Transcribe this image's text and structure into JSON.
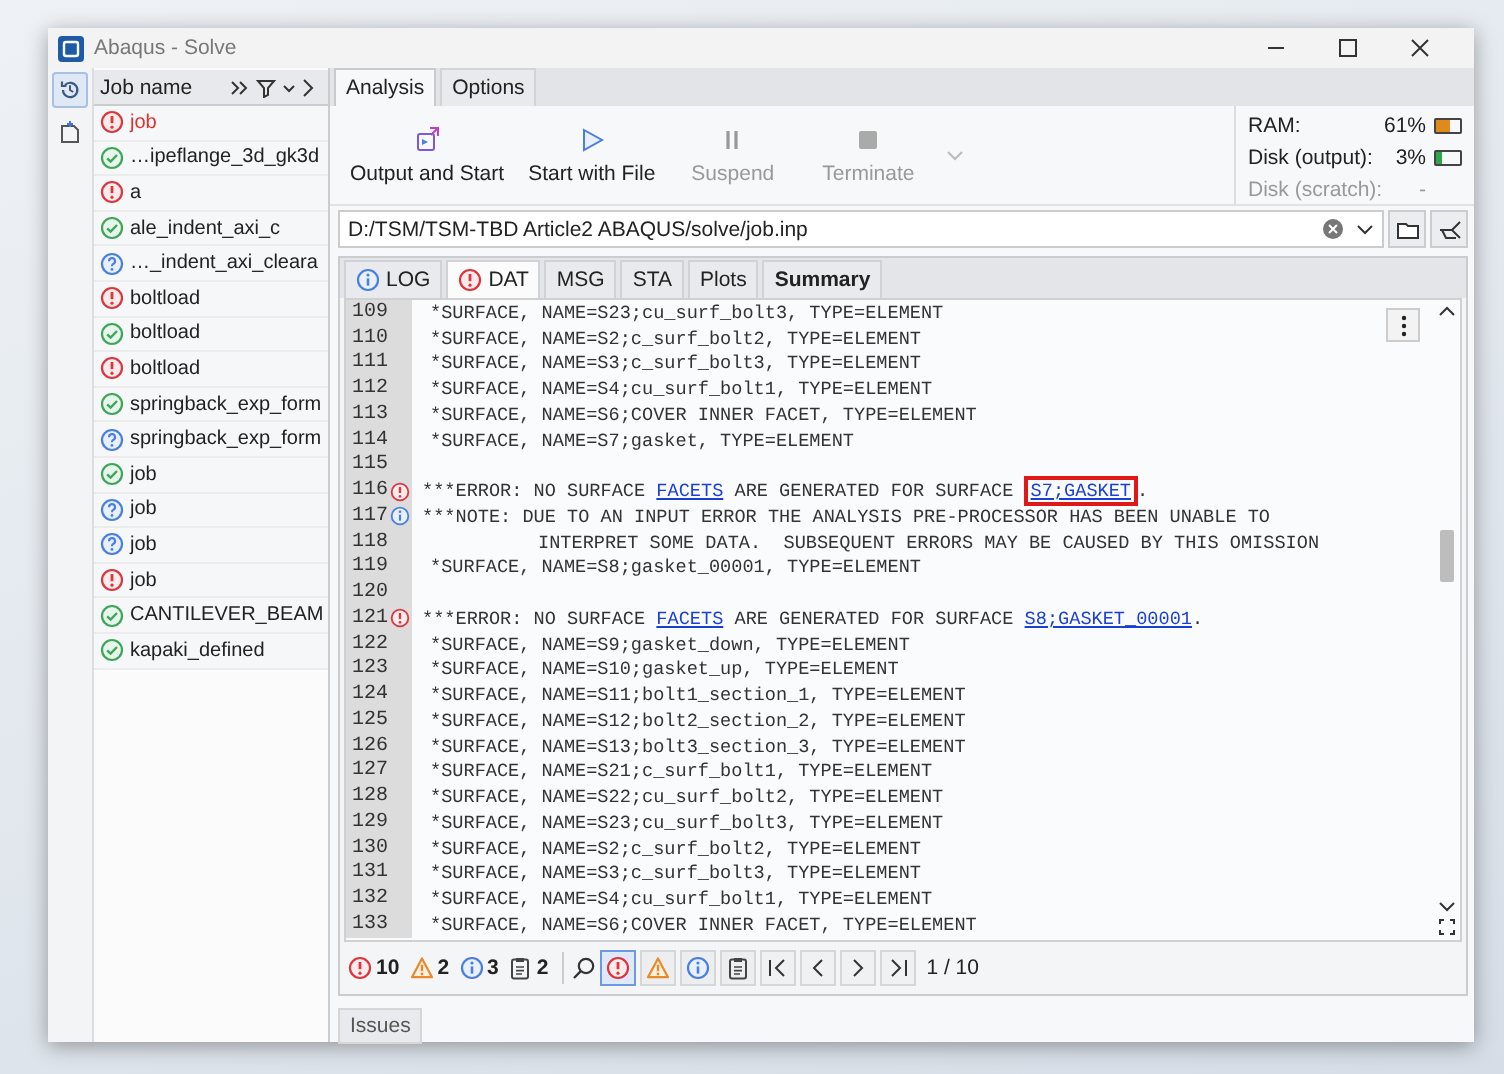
{
  "window": {
    "title": "Abaqus - Solve"
  },
  "jobs": {
    "header": "Job name",
    "items": [
      {
        "name": "job",
        "kind": "error",
        "active": true
      },
      {
        "name": "…ipeflange_3d_gk3d",
        "kind": "ok",
        "active": false
      },
      {
        "name": "a",
        "kind": "error",
        "active": false
      },
      {
        "name": "ale_indent_axi_c",
        "kind": "ok",
        "active": false
      },
      {
        "name": "…_indent_axi_cleara",
        "kind": "unknown",
        "active": false
      },
      {
        "name": "boltload",
        "kind": "error",
        "active": false
      },
      {
        "name": "boltload",
        "kind": "ok",
        "active": false
      },
      {
        "name": "boltload",
        "kind": "error",
        "active": false
      },
      {
        "name": "springback_exp_form",
        "kind": "ok",
        "active": false
      },
      {
        "name": "springback_exp_form",
        "kind": "unknown",
        "active": false
      },
      {
        "name": "job",
        "kind": "ok",
        "active": false
      },
      {
        "name": "job",
        "kind": "unknown",
        "active": false
      },
      {
        "name": "job",
        "kind": "unknown",
        "active": false
      },
      {
        "name": "job",
        "kind": "error",
        "active": false
      },
      {
        "name": "CANTILEVER_BEAM",
        "kind": "ok",
        "active": false
      },
      {
        "name": "kapaki_defined",
        "kind": "ok",
        "active": false
      }
    ]
  },
  "tabs": [
    {
      "label": "Analysis",
      "selected": true
    },
    {
      "label": "Options",
      "selected": false
    }
  ],
  "toolbar": [
    {
      "label": "Output and Start",
      "kind": "output",
      "disabled": false
    },
    {
      "label": "Start with File",
      "kind": "play",
      "disabled": false
    },
    {
      "label": "Suspend",
      "kind": "pause",
      "disabled": true
    },
    {
      "label": "Terminate",
      "kind": "stop",
      "disabled": true
    }
  ],
  "resources": [
    {
      "label": "RAM:",
      "reading": "61%",
      "level": 0.61,
      "disabled": false
    },
    {
      "label": "Disk (output):",
      "reading": "3%",
      "level": 0.03,
      "disabled": false
    },
    {
      "label": "Disk (scratch):",
      "reading": "-",
      "disabled": true
    }
  ],
  "path": {
    "value": "D:/TSM/TSM-TBD Article2 ABAQUS/solve/job.inp"
  },
  "file_tabs": [
    {
      "label": "LOG",
      "kind": "info",
      "selected": false,
      "bold": false
    },
    {
      "label": "DAT",
      "kind": "error",
      "selected": true,
      "bold": false
    },
    {
      "label": "MSG",
      "kind": "plain",
      "selected": false,
      "bold": false
    },
    {
      "label": "STA",
      "kind": "plain",
      "selected": false,
      "bold": false
    },
    {
      "label": "Plots",
      "kind": "plain",
      "selected": false,
      "bold": false
    },
    {
      "label": "Summary",
      "kind": "plain",
      "selected": false,
      "bold": true
    }
  ],
  "lines": [
    {
      "number": "109",
      "kind": "plain",
      "parts": [
        {
          "text": "*SURFACE, NAME=S23;cu_surf_bolt3, TYPE=ELEMENT"
        }
      ]
    },
    {
      "number": "110",
      "kind": "plain",
      "parts": [
        {
          "text": "*SURFACE, NAME=S2;c_surf_bolt2, TYPE=ELEMENT"
        }
      ]
    },
    {
      "number": "111",
      "kind": "plain",
      "parts": [
        {
          "text": "*SURFACE, NAME=S3;c_surf_bolt3, TYPE=ELEMENT"
        }
      ]
    },
    {
      "number": "112",
      "kind": "plain",
      "parts": [
        {
          "text": "*SURFACE, NAME=S4;cu_surf_bolt1, TYPE=ELEMENT"
        }
      ]
    },
    {
      "number": "113",
      "kind": "plain",
      "parts": [
        {
          "text": "*SURFACE, NAME=S6;COVER INNER FACET, TYPE=ELEMENT"
        }
      ]
    },
    {
      "number": "114",
      "kind": "plain",
      "parts": [
        {
          "text": "*SURFACE, NAME=S7;gasket, TYPE=ELEMENT"
        }
      ]
    },
    {
      "number": "115",
      "kind": "plain"
    },
    {
      "number": "116",
      "kind": "error",
      "parts": [
        {
          "text": "***ERROR: NO SURFACE "
        },
        {
          "text": "FACETS",
          "link": true,
          "highlighted": false
        },
        {
          "text": " ARE GENERATED FOR SURFACE "
        },
        {
          "text": "S7;GASKET",
          "link": true,
          "highlighted": true
        },
        {
          "text": "."
        }
      ]
    },
    {
      "number": "117",
      "kind": "note",
      "parts": [
        {
          "text": "***NOTE: DUE TO AN INPUT ERROR THE ANALYSIS PRE-PROCESSOR HAS BEEN UNABLE TO"
        }
      ]
    },
    {
      "number": "118",
      "kind": "continuation",
      "parts": [
        {
          "text": "INTERPRET SOME DATA.  SUBSEQUENT ERRORS MAY BE CAUSED BY THIS OMISSION"
        }
      ]
    },
    {
      "number": "119",
      "kind": "plain",
      "parts": [
        {
          "text": "*SURFACE, NAME=S8;gasket_00001, TYPE=ELEMENT"
        }
      ]
    },
    {
      "number": "120",
      "kind": "plain"
    },
    {
      "number": "121",
      "kind": "error",
      "parts": [
        {
          "text": "***ERROR: NO SURFACE "
        },
        {
          "text": "FACETS",
          "link": true,
          "highlighted": false
        },
        {
          "text": " ARE GENERATED FOR SURFACE "
        },
        {
          "text": "S8;GASKET_00001",
          "link": true,
          "highlighted": false
        },
        {
          "text": "."
        }
      ]
    },
    {
      "number": "122",
      "kind": "plain",
      "parts": [
        {
          "text": "*SURFACE, NAME=S9;gasket_down, TYPE=ELEMENT"
        }
      ]
    },
    {
      "number": "123",
      "kind": "plain",
      "parts": [
        {
          "text": "*SURFACE, NAME=S10;gasket_up, TYPE=ELEMENT"
        }
      ]
    },
    {
      "number": "124",
      "kind": "plain",
      "parts": [
        {
          "text": "*SURFACE, NAME=S11;bolt1_section_1, TYPE=ELEMENT"
        }
      ]
    },
    {
      "number": "125",
      "kind": "plain",
      "parts": [
        {
          "text": "*SURFACE, NAME=S12;bolt2_section_2, TYPE=ELEMENT"
        }
      ]
    },
    {
      "number": "126",
      "kind": "plain",
      "parts": [
        {
          "text": "*SURFACE, NAME=S13;bolt3_section_3, TYPE=ELEMENT"
        }
      ]
    },
    {
      "number": "127",
      "kind": "plain",
      "parts": [
        {
          "text": "*SURFACE, NAME=S21;c_surf_bolt1, TYPE=ELEMENT"
        }
      ]
    },
    {
      "number": "128",
      "kind": "plain",
      "parts": [
        {
          "text": "*SURFACE, NAME=S22;cu_surf_bolt2, TYPE=ELEMENT"
        }
      ]
    },
    {
      "number": "129",
      "kind": "plain",
      "parts": [
        {
          "text": "*SURFACE, NAME=S23;cu_surf_bolt3, TYPE=ELEMENT"
        }
      ]
    },
    {
      "number": "130",
      "kind": "plain",
      "parts": [
        {
          "text": "*SURFACE, NAME=S2;c_surf_bolt2, TYPE=ELEMENT"
        }
      ]
    },
    {
      "number": "131",
      "kind": "plain",
      "parts": [
        {
          "text": "*SURFACE, NAME=S3;c_surf_bolt3, TYPE=ELEMENT"
        }
      ]
    },
    {
      "number": "132",
      "kind": "plain",
      "parts": [
        {
          "text": "*SURFACE, NAME=S4;cu_surf_bolt1, TYPE=ELEMENT"
        }
      ]
    },
    {
      "number": "133",
      "kind": "plain",
      "parts": [
        {
          "text": "*SURFACE, NAME=S6;COVER INNER FACET, TYPE=ELEMENT"
        }
      ]
    }
  ],
  "counts": [
    {
      "kind": "error",
      "count": "10"
    },
    {
      "kind": "warning",
      "count": "2"
    },
    {
      "kind": "info",
      "count": "3"
    },
    {
      "kind": "log",
      "count": "2"
    }
  ],
  "filters": [
    {
      "kind": "error",
      "selected": true
    },
    {
      "kind": "warning",
      "selected": false
    },
    {
      "kind": "info",
      "selected": false
    },
    {
      "kind": "log",
      "selected": false
    }
  ],
  "position": "1 / 10",
  "bottom_tabs": [
    {
      "label": "Issues"
    }
  ]
}
